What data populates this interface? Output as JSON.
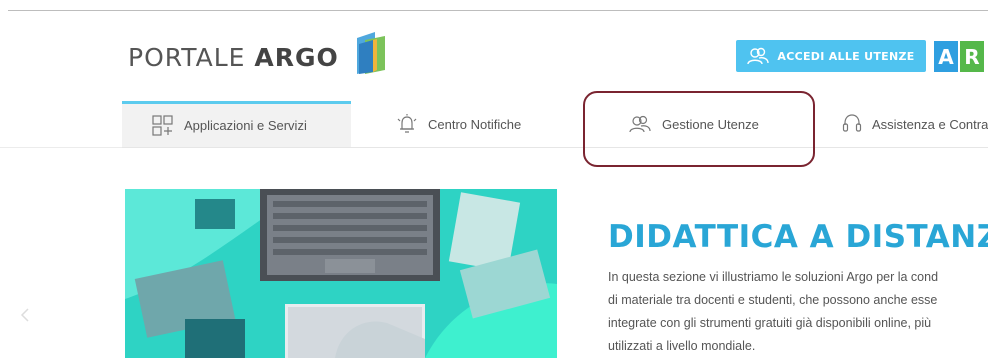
{
  "header": {
    "logo_text_light": "PORTALE",
    "logo_text_bold": "ARGO",
    "login_button": "ACCEDI ALLE UTENZE",
    "brand_letters": [
      "A",
      "R"
    ],
    "brand_colors": [
      "#2f9fe0",
      "#55b84a"
    ]
  },
  "nav": {
    "items": [
      {
        "label": "Applicazioni e Servizi",
        "icon": "apps-grid-icon",
        "active": true
      },
      {
        "label": "Centro Notifiche",
        "icon": "bell-icon",
        "active": false
      },
      {
        "label": "Gestione Utenze",
        "icon": "users-icon",
        "active": false
      },
      {
        "label": "Assistenza e Contra",
        "icon": "headset-icon",
        "active": false
      }
    ]
  },
  "hero": {
    "title": "DIDATTICA A DISTANZ",
    "lines": [
      "In questa sezione vi illustriamo le soluzioni Argo per la cond",
      "di materiale tra docenti e studenti, che possono anche esse",
      "integrate con gli strumenti gratuiti già disponibili online, più",
      "utilizzati a livello mondiale."
    ]
  },
  "colors": {
    "accent": "#4fc3f0",
    "title": "#29a6d6",
    "highlight_border": "#7a2430"
  }
}
